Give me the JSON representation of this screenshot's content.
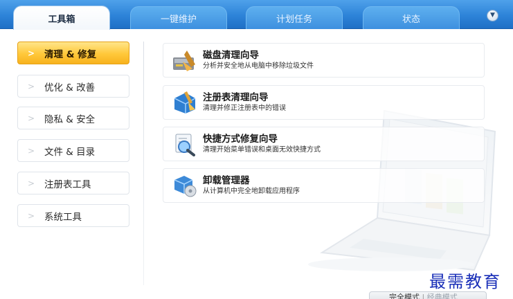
{
  "tabs": [
    {
      "label": "工具箱",
      "active": true
    },
    {
      "label": "一键维护",
      "active": false
    },
    {
      "label": "计划任务",
      "active": false
    },
    {
      "label": "状态",
      "active": false
    }
  ],
  "menu_icon": "chevron-down-circle-icon",
  "sidebar": {
    "items": [
      {
        "label": "清理 & 修复",
        "selected": true
      },
      {
        "label": "优化 & 改善",
        "selected": false
      },
      {
        "label": "隐私 & 安全",
        "selected": false
      },
      {
        "label": "文件 & 目录",
        "selected": false
      },
      {
        "label": "注册表工具",
        "selected": false
      },
      {
        "label": "系统工具",
        "selected": false
      }
    ]
  },
  "tools": [
    {
      "title": "磁盘清理向导",
      "desc": "分析并安全地从电脑中移除垃圾文件",
      "icon": "disk-cleanup-icon"
    },
    {
      "title": "注册表清理向导",
      "desc": "清理并修正注册表中的错误",
      "icon": "registry-cleanup-icon"
    },
    {
      "title": "快捷方式修复向导",
      "desc": "清理开始菜单错误和桌面无效快捷方式",
      "icon": "shortcut-repair-icon"
    },
    {
      "title": "卸载管理器",
      "desc": "从计算机中完全地卸载应用程序",
      "icon": "uninstall-manager-icon"
    }
  ],
  "footer": {
    "safe_mode": "完全模式",
    "separator": "|",
    "classic_mode": "经典模式"
  },
  "watermark": "最需教育",
  "colors": {
    "topbar": "#2d83d8",
    "selected_item": "#ffc83a",
    "watermark": "#1a2fb8"
  }
}
